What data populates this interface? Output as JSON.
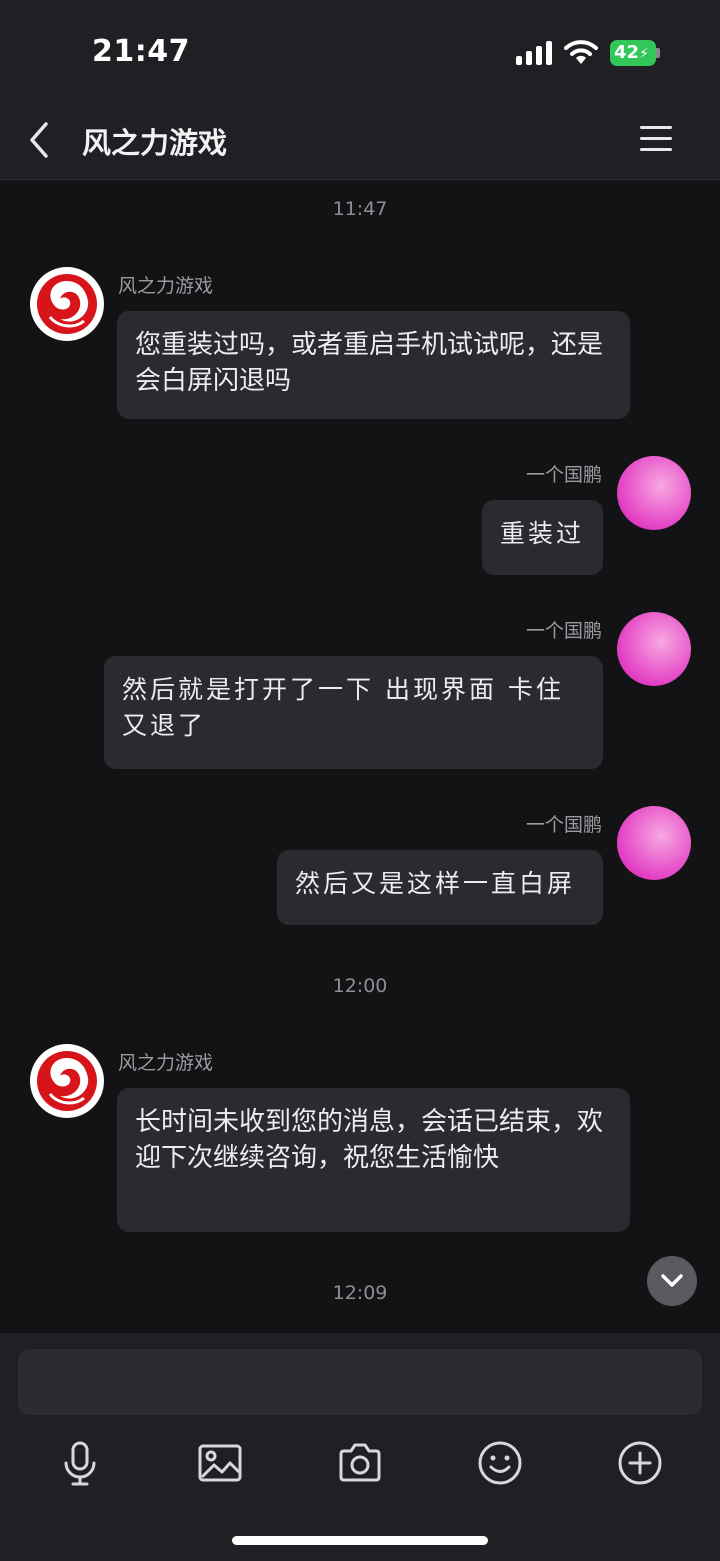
{
  "status_bar": {
    "time": "21:47",
    "battery": "42"
  },
  "header": {
    "title": "风之力游戏",
    "back_icon": "chevron-left-icon",
    "menu_icon": "hamburger-menu-icon"
  },
  "messages": [
    {
      "type": "timestamp",
      "text": "11:47"
    },
    {
      "type": "incoming",
      "sender": "风之力游戏",
      "text": "您重装过吗，或者重启手机试试呢，还是会白屏闪退吗"
    },
    {
      "type": "outgoing",
      "sender": "一个国鹏",
      "text": "重装过"
    },
    {
      "type": "outgoing",
      "sender": "一个国鹏",
      "text": "然后就是打开了一下 出现界面 卡住又退了"
    },
    {
      "type": "outgoing",
      "sender": "一个国鹏",
      "text": "然后又是这样一直白屏"
    },
    {
      "type": "timestamp",
      "text": "12:00"
    },
    {
      "type": "incoming",
      "sender": "风之力游戏",
      "text": "长时间未收到您的消息，会话已结束，欢迎下次继续咨询，祝您生活愉快"
    },
    {
      "type": "timestamp",
      "text": "12:09"
    }
  ],
  "composer": {
    "placeholder": "",
    "tools": [
      "microphone-icon",
      "image-icon",
      "camera-icon",
      "emoji-icon",
      "plus-circle-icon"
    ]
  },
  "colors": {
    "background": "#131316",
    "bar": "#202024",
    "bubble": "#2b2b2f",
    "battery": "#32c759",
    "logo_red": "#d8141b"
  }
}
